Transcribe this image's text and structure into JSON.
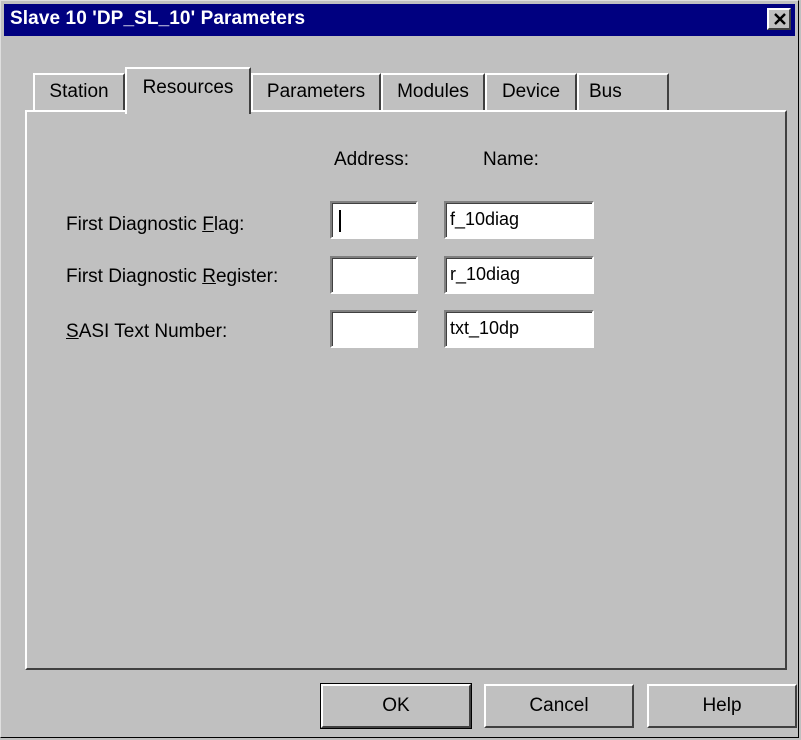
{
  "window": {
    "title": "Slave 10 'DP_SL_10' Parameters"
  },
  "tabs": [
    {
      "label": "Station",
      "active": false
    },
    {
      "label": "Resources",
      "active": true
    },
    {
      "label": "Parameters",
      "active": false
    },
    {
      "label": "Modules",
      "active": false
    },
    {
      "label": "Device",
      "active": false
    },
    {
      "label": "Bus",
      "active": false
    }
  ],
  "resources": {
    "header_address": "Address:",
    "header_name": "Name:",
    "rows": [
      {
        "label_pre": "First Diagnostic ",
        "label_mnemonic": "F",
        "label_post": "lag:",
        "address": "",
        "name": "f_10diag"
      },
      {
        "label_pre": "First Diagnostic ",
        "label_mnemonic": "R",
        "label_post": "egister:",
        "address": "",
        "name": "r_10diag"
      },
      {
        "label_pre": "",
        "label_mnemonic": "S",
        "label_post": "ASI Text Number:",
        "address": "",
        "name": "txt_10dp"
      }
    ]
  },
  "buttons": {
    "ok": "OK",
    "cancel": "Cancel",
    "help": "Help"
  },
  "icons": {
    "close": "close-icon"
  },
  "colors": {
    "titlebar": "#000080",
    "face": "#c0c0c0"
  }
}
